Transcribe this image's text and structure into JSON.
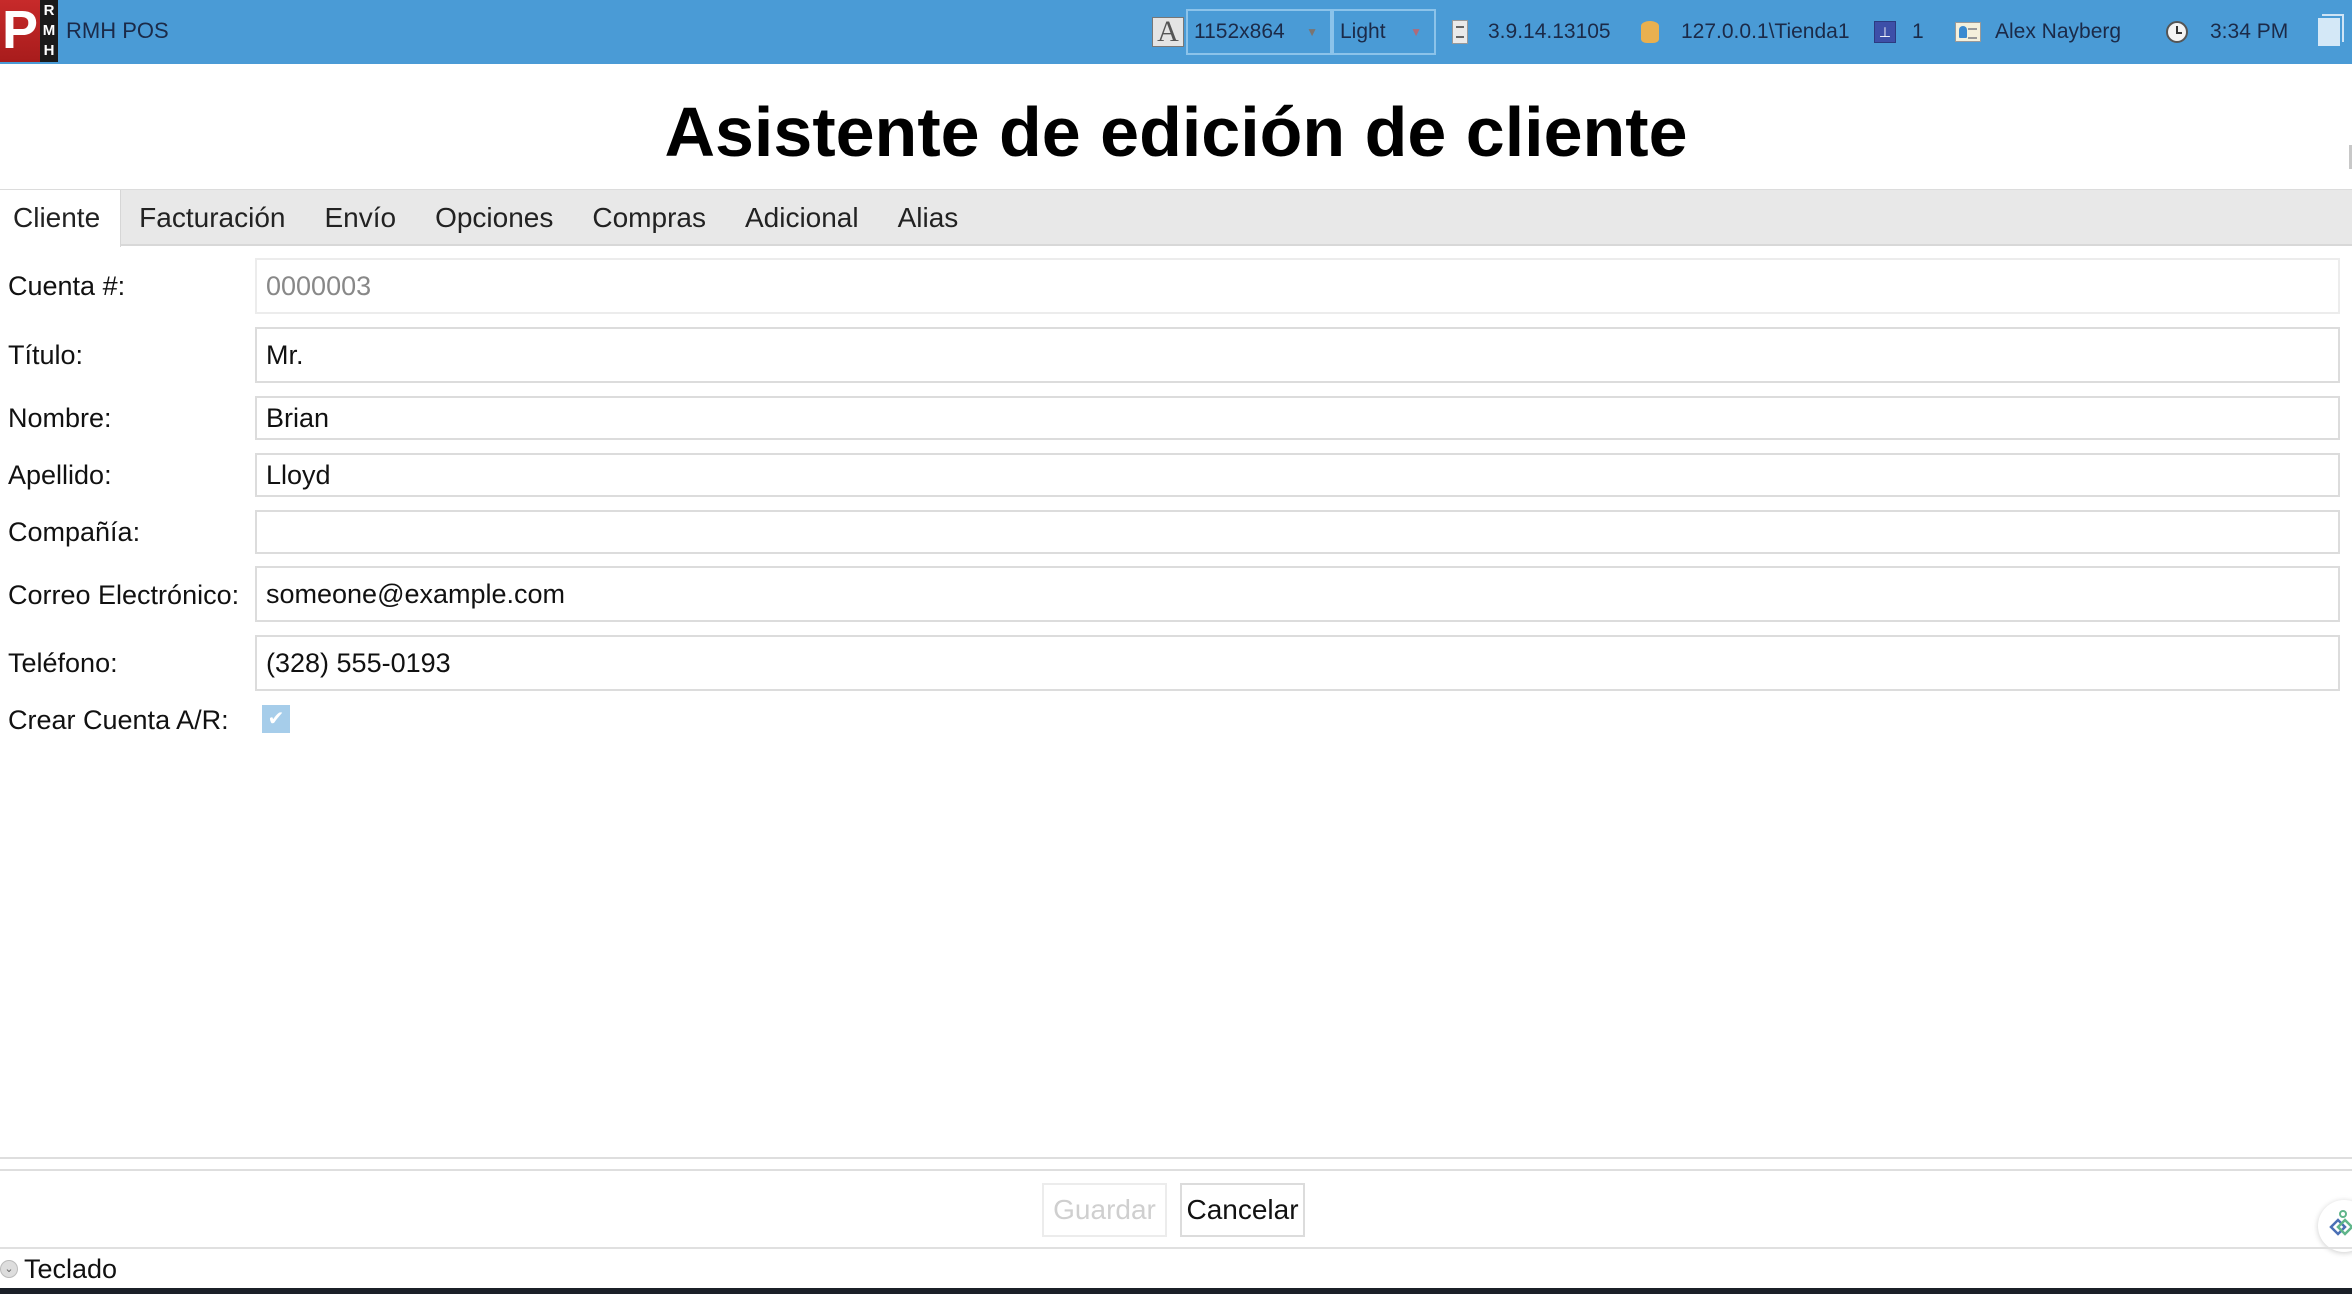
{
  "topbar": {
    "logo_letter": "P",
    "logo_sub": [
      "R",
      "M",
      "H"
    ],
    "app_title": "RMH POS",
    "resolution": "1152x864",
    "theme": "Light",
    "version": "3.9.14.13105",
    "database": "127.0.0.1\\Tienda1",
    "register": "1",
    "user": "Alex Nayberg",
    "time": "3:34 PM",
    "icons": [
      "font-size-icon",
      "cabinet-icon",
      "database-icon",
      "register-icon",
      "user-card-icon",
      "clock-icon",
      "window-icon"
    ]
  },
  "heading": "Asistente de edición de cliente",
  "tabs": [
    {
      "label": "Cliente",
      "active": true
    },
    {
      "label": "Facturación",
      "active": false
    },
    {
      "label": "Envío",
      "active": false
    },
    {
      "label": "Opciones",
      "active": false
    },
    {
      "label": "Compras",
      "active": false
    },
    {
      "label": "Adicional",
      "active": false
    },
    {
      "label": "Alias",
      "active": false
    }
  ],
  "form": {
    "account": {
      "label": "Cuenta #:",
      "value": "0000003"
    },
    "title": {
      "label": "Título:",
      "value": "Mr."
    },
    "first_name": {
      "label": "Nombre:",
      "value": "Brian"
    },
    "last_name": {
      "label": "Apellido:",
      "value": "Lloyd"
    },
    "company": {
      "label": "Compañía:",
      "value": ""
    },
    "email": {
      "label": "Correo Electrónico:",
      "value": "someone@example.com"
    },
    "phone": {
      "label": "Teléfono:",
      "value": "(328) 555-0193"
    },
    "create_ar": {
      "label": "Crear Cuenta A/R:",
      "checked": true
    }
  },
  "buttons": {
    "save": "Guardar",
    "cancel": "Cancelar"
  },
  "keyboard_toggle": "Teclado",
  "colors": {
    "topbar": "#4a9bd6",
    "tabbar": "#e8e8e8",
    "checkbox": "#a6cdea"
  }
}
